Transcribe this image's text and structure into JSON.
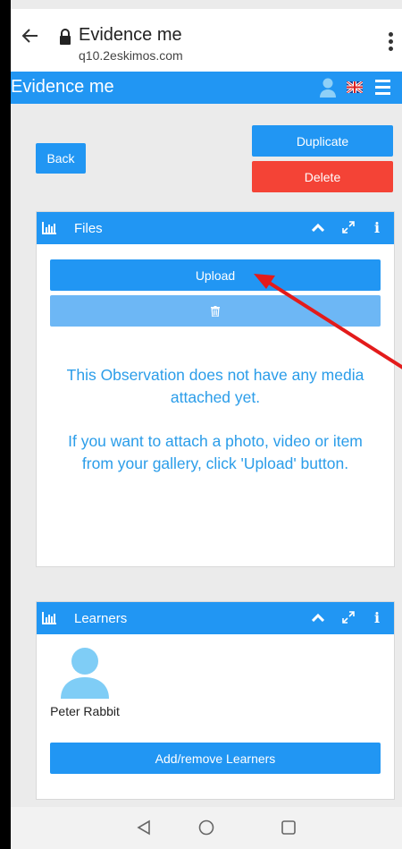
{
  "browser": {
    "title": "Evidence me",
    "url": "q10.2eskimos.com"
  },
  "app_bar": {
    "title": "Evidence me"
  },
  "actions": {
    "back_label": "Back",
    "duplicate_label": "Duplicate",
    "delete_label": "Delete"
  },
  "files_panel": {
    "title": "Files",
    "upload_label": "Upload",
    "empty_line1": "This Observation does not have any media attached yet.",
    "empty_line2": "If you want to attach a photo, video or item from your gallery, click 'Upload' button."
  },
  "learners_panel": {
    "title": "Learners",
    "learner_name": "Peter Rabbit",
    "add_remove_label": "Add/remove Learners"
  },
  "colors": {
    "primary": "#2196f3",
    "danger": "#f44336",
    "annotation": "#e31b1b"
  }
}
